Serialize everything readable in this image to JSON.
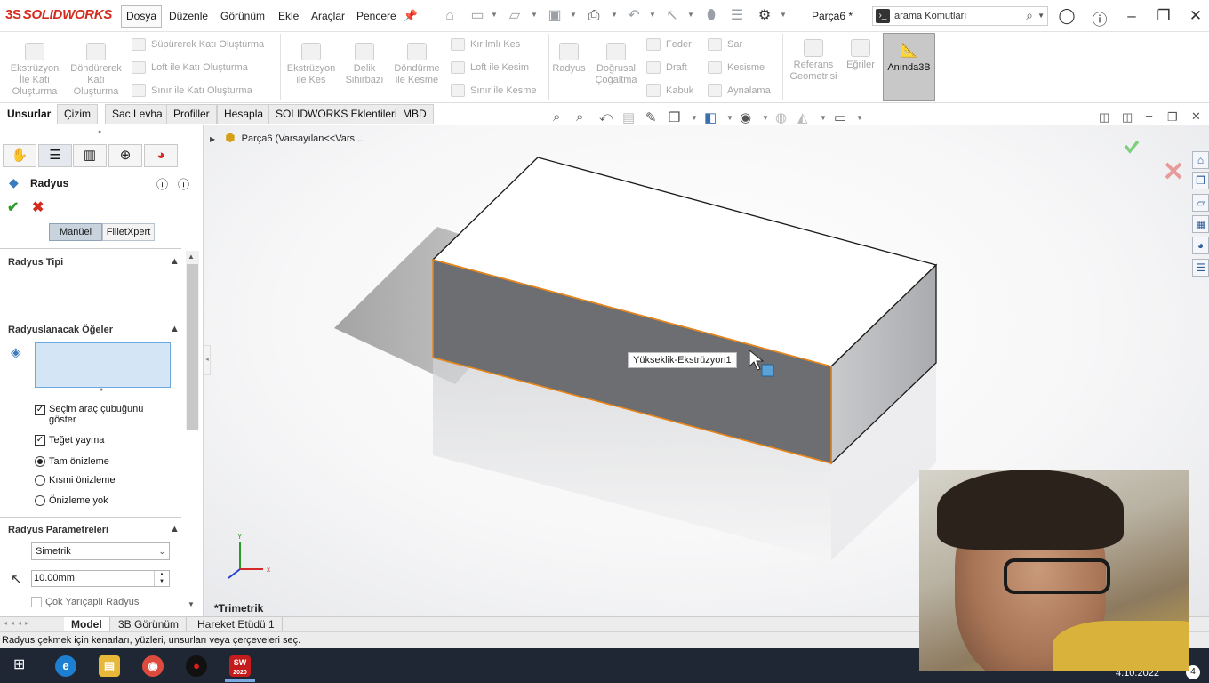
{
  "titlebar": {
    "logo_text": "SOLIDWORKS",
    "logo_mark": "3S",
    "menus": [
      "Dosya",
      "Düzenle",
      "Görünüm",
      "Ekle",
      "Araçlar",
      "Pencere"
    ],
    "doc_title": "Parça6 *",
    "search_placeholder": "arama Komutları"
  },
  "ribbon": {
    "col1": [
      "Ekstrüzyon İle Katı Oluşturma",
      "Döndürerek Katı Oluşturma"
    ],
    "col2": [
      "Süpürerek Katı Oluşturma",
      "Loft ile Katı Oluşturma",
      "Sınır ile Katı Oluşturma"
    ],
    "col3": [
      "Ekstrüzyon ile Kes",
      "Delik Sihirbazı",
      "Döndürme ile Kesme"
    ],
    "col4": [
      "Kırılmlı Kes",
      "Loft ile Kesim",
      "Sınır ile Kesme"
    ],
    "col5": [
      "Radyus",
      "Doğrusal Çoğaltma"
    ],
    "col6": [
      "Feder",
      "Draft",
      "Kabuk"
    ],
    "col7": [
      "Sar",
      "Kesisme",
      "Aynalama"
    ],
    "col8": [
      "Referans Geometrisi",
      "Eğriler"
    ],
    "instant3d": "Anında3B"
  },
  "tabs": [
    "Unsurlar",
    "Çizim",
    "Sac Levha",
    "Profiller",
    "Hesapla",
    "SOLIDWORKS Eklentileri",
    "MBD"
  ],
  "panel": {
    "title": "Radyus",
    "modes": [
      "Manüel",
      "FilletXpert"
    ],
    "sections": {
      "type": "Radyus Tipi",
      "items": "Radyuslanacak Öğeler",
      "params": "Radyus Parametreleri"
    },
    "options": {
      "show_toolbar": "Seçim araç çubuğunu göster",
      "tangent": "Teğet yayma",
      "full_preview": "Tam önizleme",
      "partial_preview": "Kısmi önizleme",
      "no_preview": "Önizleme yok"
    },
    "method": "Simetrik",
    "radius_value": "10.00mm",
    "multi_radius": "Çok Yarıçaplı Radyus"
  },
  "viewport": {
    "tree_root": "Parça6  (Varsayılan<<Vars...",
    "tooltip": "Yükseklik-Ekstrüzyon1",
    "view_name": "*Trimetrik",
    "triad": {
      "x": "x",
      "y": "Y"
    }
  },
  "bottom_tabs": [
    "Model",
    "3B Görünüm",
    "Hareket Etüdü 1"
  ],
  "status_text": "Radyus çekmek için kenarları, yüzleri, unsurları veya çerçeveleri seç.",
  "taskbar": {
    "sw_label": "2020",
    "date": "4.10.2022",
    "badge": "4"
  },
  "colors": {
    "accent": "#d52b1e",
    "selection_edge": "#e8871e",
    "face_dark": "#6e6f72",
    "ok_green": "#2e9b2e",
    "cancel_red": "#d52b1e"
  }
}
